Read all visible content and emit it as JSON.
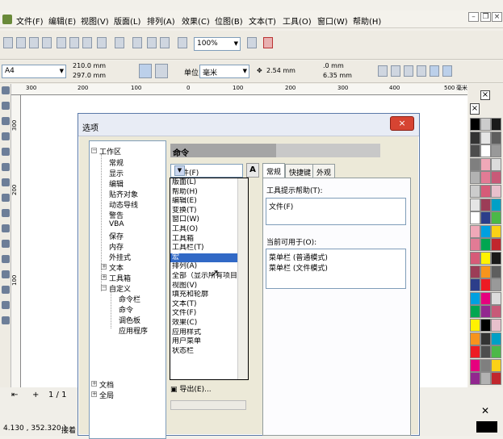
{
  "menu": {
    "items": [
      "文件(F)",
      "编辑(E)",
      "视图(V)",
      "版面(L)",
      "排列(A)",
      "效果(C)",
      "位图(B)",
      "文本(T)",
      "工具(O)",
      "窗口(W)",
      "帮助(H)"
    ]
  },
  "toolbar": {
    "zoom_value": "100%"
  },
  "propbar": {
    "page_size": "A4",
    "width": "210.0 mm",
    "height": "297.0 mm",
    "units_label": "单位:",
    "units_value": "毫米",
    "nudge": "2.54 mm",
    "dup_x": ".0 mm",
    "dup_y": "6.35 mm"
  },
  "ruler": {
    "h_ticks": [
      "300",
      "200",
      "100",
      "0",
      "100",
      "200",
      "300",
      "400",
      "500"
    ],
    "v_ticks": [
      "300",
      "200",
      "100"
    ],
    "unit": "毫米"
  },
  "status": {
    "page_indicator": "1 / 1",
    "coords": "4.130 , 352.320 )",
    "next_text": "接着"
  },
  "dialog": {
    "title": "选项",
    "close_icon": "×",
    "section_title": "命令",
    "tree": [
      {
        "label": "工作区",
        "expander": "−"
      },
      {
        "label": "常规"
      },
      {
        "label": "显示"
      },
      {
        "label": "编辑"
      },
      {
        "label": "贴齐对象"
      },
      {
        "label": "动态导线"
      },
      {
        "label": "警告"
      },
      {
        "label": "VBA"
      },
      {
        "label": "保存"
      },
      {
        "label": "内存"
      },
      {
        "label": "外挂式"
      },
      {
        "label": "文本",
        "expander": "+"
      },
      {
        "label": "工具箱",
        "expander": "+"
      },
      {
        "label": "自定义",
        "expander": "−"
      },
      {
        "label": "命令栏"
      },
      {
        "label": "命令"
      },
      {
        "label": "调色板"
      },
      {
        "label": "应用程序"
      },
      {
        "label": "文档",
        "expander": "+"
      },
      {
        "label": "全局",
        "expander": "+"
      }
    ],
    "select_value": "文件(F)",
    "dropdown_options": [
      "版面(L)",
      "帮助(H)",
      "编辑(E)",
      "变换(T)",
      "窗口(W)",
      "工具(O)",
      "工具箱",
      "工具栏(T)",
      "宏",
      "排列(A)",
      "全部（显示所有项目）",
      "视图(V)",
      "填充和轮廓",
      "文本(T)",
      "文件(F)",
      "效果(C)",
      "应用样式",
      "用户菜单",
      "状态栏"
    ],
    "highlighted_option": "宏",
    "export_label": "导出(E)...",
    "tabs": [
      "常规",
      "快捷键",
      "外观"
    ],
    "active_tab": "常规",
    "tooltip_label": "工具提示帮助(T):",
    "tooltip_value": "文件(F)",
    "usedin_label": "当前可用于(O):",
    "usedin_values": [
      "菜单栏 (普通模式)",
      "菜单栏 (文件模式)"
    ]
  },
  "palette": {
    "colors": [
      "#000000",
      "#333333",
      "#4d4d4d",
      "#7f7f7f",
      "#b2b2b2",
      "#cccccc",
      "#e5e5e5",
      "#ffffff",
      "#f0a8b8",
      "#e27b95",
      "#d65b78",
      "#9c3d57",
      "#2c3e8a",
      "#00a0e0",
      "#00a651",
      "#fff200",
      "#f7941d",
      "#ed1c24",
      "#e6007e",
      "#92278f"
    ]
  }
}
